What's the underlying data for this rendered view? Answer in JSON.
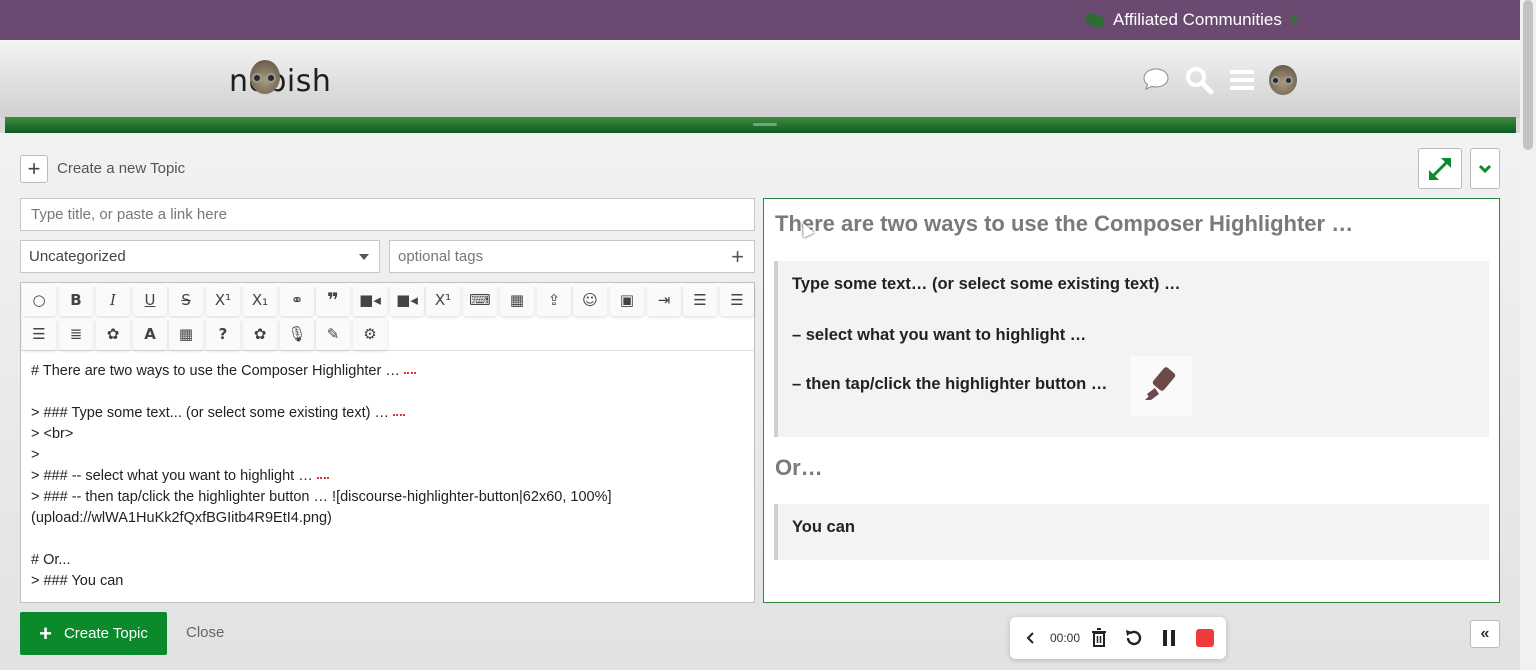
{
  "topbar": {
    "affiliated_label": "Affiliated Communities"
  },
  "header": {
    "logo_text": "nobish",
    "icons": [
      "chat-icon",
      "search-icon",
      "menu-icon",
      "avatar-icon"
    ]
  },
  "composer": {
    "action_label": "Create a new Topic",
    "title_placeholder": "Type title, or paste a link here",
    "category_value": "Uncategorized",
    "tags_placeholder": "optional tags",
    "toolbar_icons": [
      "speech-bubble-icon",
      "bold-icon",
      "italic-icon",
      "underline-icon",
      "strikethrough-icon",
      "superscript-icon",
      "subscript-icon",
      "link-icon",
      "blockquote-icon",
      "video-icon",
      "video-camera-icon",
      "superscript-2-icon",
      "keyboard-icon",
      "table-icon",
      "upload-icon",
      "emoji-icon",
      "image-icon",
      "indent-icon",
      "align-left-icon",
      "align-center-icon",
      "align-right-icon",
      "justify-icon",
      "palette-icon",
      "font-color-icon",
      "calendar-icon",
      "help-icon",
      "palette-2-icon",
      "microphone-icon",
      "highlighter-icon",
      "gear-icon"
    ],
    "raw_lines": [
      "# There are two ways to use the Composer Highlighter …",
      "",
      "> ### Type some text... (or select some existing text) …",
      "> <br>",
      ">",
      "> ### -- select what you want to highlight …",
      "> ### -- then tap/click the highlighter button … ![discourse-highlighter-button|62x60, 100%]",
      "(upload://wlWA1HuKk2fQxfBGIitb4R9EtI4.png)",
      "",
      "# Or...",
      "> ### You can"
    ],
    "create_label": "Create Topic",
    "close_label": "Close"
  },
  "preview": {
    "heading": "There are two ways to use the Composer Highlighter …",
    "quote1": [
      "Type some text… (or select some existing text) …",
      "– select what you want to highlight …",
      "– then tap/click the highlighter button …"
    ],
    "or_heading": "Or…",
    "quote2": "You can"
  },
  "recorder": {
    "time": "00:00"
  },
  "colors": {
    "topbar": "#6b4a72",
    "accent_green": "#0a8a2a",
    "record_red": "#f03b3b"
  }
}
